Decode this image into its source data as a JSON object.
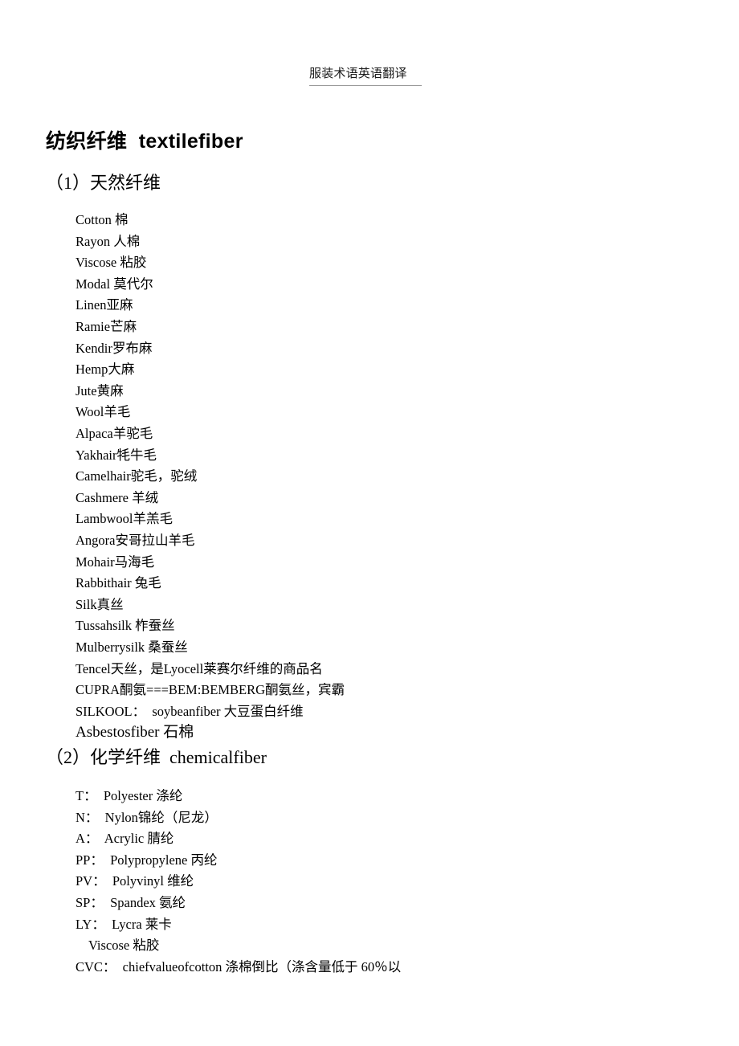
{
  "header": {
    "title": "服装术语英语翻译"
  },
  "document": {
    "heading": "纺织纤维  textilefiber",
    "sections": [
      {
        "heading": "（1）天然纤维",
        "items": [
          {
            "text": "Cotton 棉",
            "indent": "normal",
            "size": "normal"
          },
          {
            "text": "Rayon 人棉",
            "indent": "normal",
            "size": "normal"
          },
          {
            "text": "Viscose 粘胶",
            "indent": "normal",
            "size": "normal"
          },
          {
            "text": "Modal 莫代尔",
            "indent": "normal",
            "size": "normal"
          },
          {
            "text": "Linen亚麻",
            "indent": "normal",
            "size": "normal"
          },
          {
            "text": "Ramie芒麻",
            "indent": "normal",
            "size": "normal"
          },
          {
            "text": "Kendir罗布麻",
            "indent": "normal",
            "size": "normal"
          },
          {
            "text": "Hemp大麻",
            "indent": "normal",
            "size": "normal"
          },
          {
            "text": "Jute黄麻",
            "indent": "normal",
            "size": "normal"
          },
          {
            "text": "Wool羊毛",
            "indent": "normal",
            "size": "normal"
          },
          {
            "text": "Alpaca羊驼毛",
            "indent": "normal",
            "size": "normal"
          },
          {
            "text": "Yakhair牦牛毛",
            "indent": "normal",
            "size": "normal"
          },
          {
            "text": "Camelhair驼毛，驼绒",
            "indent": "normal",
            "size": "normal"
          },
          {
            "text": "Cashmere 羊绒",
            "indent": "normal",
            "size": "normal"
          },
          {
            "text": "Lambwool羊羔毛",
            "indent": "normal",
            "size": "normal"
          },
          {
            "text": "Angora安哥拉山羊毛",
            "indent": "normal",
            "size": "normal"
          },
          {
            "text": "Mohair马海毛",
            "indent": "normal",
            "size": "normal"
          },
          {
            "text": "Rabbithair 兔毛",
            "indent": "normal",
            "size": "normal"
          },
          {
            "text": "Silk真丝",
            "indent": "normal",
            "size": "normal"
          },
          {
            "text": "Tussahsilk 柞蚕丝",
            "indent": "normal",
            "size": "normal"
          },
          {
            "text": "Mulberrysilk 桑蚕丝",
            "indent": "normal",
            "size": "normal"
          },
          {
            "text": "Tencel天丝，是Lyocell莱赛尔纤维的商品名",
            "indent": "normal",
            "size": "normal"
          },
          {
            "text": "CUPRA酮氨===BEM:BEMBERG酮氨丝，宾霸",
            "indent": "normal",
            "size": "normal"
          },
          {
            "text": "SILKOOL：  soybeanfiber 大豆蛋白纤维",
            "indent": "normal",
            "size": "normal"
          },
          {
            "text": "Asbestosfiber 石棉",
            "indent": "normal",
            "size": "big"
          }
        ]
      },
      {
        "heading": "（2）化学纤维  chemicalfiber",
        "items": [
          {
            "text": "T：  Polyester 涤纶",
            "indent": "normal",
            "size": "normal"
          },
          {
            "text": "N：  Nylon锦纶（尼龙）",
            "indent": "normal",
            "size": "normal"
          },
          {
            "text": "A：  Acrylic 腈纶",
            "indent": "normal",
            "size": "normal"
          },
          {
            "text": "PP：  Polypropylene 丙纶",
            "indent": "normal",
            "size": "normal"
          },
          {
            "text": "PV：  Polyvinyl 维纶",
            "indent": "normal",
            "size": "normal"
          },
          {
            "text": "SP：  Spandex 氨纶",
            "indent": "normal",
            "size": "normal"
          },
          {
            "text": "LY：  Lycra 莱卡",
            "indent": "normal",
            "size": "normal"
          },
          {
            "text": "Viscose 粘胶",
            "indent": "extra",
            "size": "normal"
          },
          {
            "text": "CVC：  chiefvalueofcotton 涤棉倒比（涤含量低于 60％以",
            "indent": "normal",
            "size": "normal"
          }
        ]
      }
    ]
  }
}
